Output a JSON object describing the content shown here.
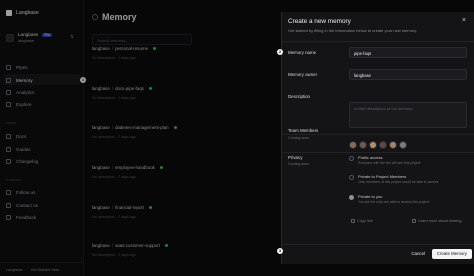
{
  "brand": {
    "name": "Langbase"
  },
  "org": {
    "name": "Langbase",
    "plan_badge": "Pro",
    "subtitle": "langbase"
  },
  "sidebar": {
    "items": [
      {
        "label": "Pipes",
        "icon": "pipe-icon"
      },
      {
        "label": "Memory",
        "icon": "memory-icon"
      },
      {
        "label": "Analytics",
        "icon": "analytics-icon"
      },
      {
        "label": "Explore",
        "icon": "explore-icon"
      }
    ],
    "section_learn": "Learn",
    "learn_items": [
      {
        "label": "Docs"
      },
      {
        "label": "Guides"
      },
      {
        "label": "Changelog"
      }
    ],
    "section_connect": "Connect",
    "connect_items": [
      {
        "label": "Follow us"
      },
      {
        "label": "Contact us"
      },
      {
        "label": "Feedback"
      }
    ],
    "badge": "1",
    "footer": {
      "left": "Langbase",
      "right": "Get Started Here"
    }
  },
  "main": {
    "title": "Memory",
    "search_placeholder": "Search memory...",
    "memories": [
      {
        "owner": "langbase",
        "name": "personal-resume",
        "desc": "No description",
        "time": "2 days ago"
      },
      {
        "owner": "langbase",
        "name": "docs-pipe-faqs",
        "desc": "No description",
        "time": "2 days ago"
      },
      {
        "owner": "langbase",
        "name": "diabetes-management-plan",
        "desc": "No description",
        "time": "2 days ago"
      },
      {
        "owner": "langbase",
        "name": "employee-handbook",
        "desc": "No description",
        "time": "2 days ago"
      },
      {
        "owner": "langbase",
        "name": "financial-report",
        "desc": "No description",
        "time": "2 days ago"
      },
      {
        "owner": "langbase",
        "name": "saas-customer-support",
        "desc": "No description",
        "time": "2 days ago"
      }
    ]
  },
  "modal": {
    "title": "Create a new memory",
    "description": "Get started by filling in the information below to create your new memory.",
    "memory_name_label": "Memory name",
    "memory_name_value": "pipe-faqs",
    "memory_owner_label": "Memory owner",
    "memory_owner_value": "langbase",
    "description_label": "Description",
    "description_placeholder": "A brief description of the memory",
    "team_members_label": "Team Members",
    "team_members_sub": "Coming soon",
    "privacy_label": "Privacy",
    "privacy_sub": "Coming soon",
    "privacy_options": [
      {
        "title": "Public access",
        "sub": "Everyone with the link will see this project",
        "checked": false
      },
      {
        "title": "Private to Project Members",
        "sub": "Only members of this project would be able to access",
        "checked": false
      },
      {
        "title": "Private to you",
        "sub": "You are the only one able to access this project",
        "checked": true
      }
    ],
    "copy_link": "Copy link",
    "learn_more": "Learn more about sharing",
    "cancel": "Cancel",
    "create": "Create Memory",
    "step_top": "2",
    "step_bottom": "3"
  },
  "colors": {
    "accent": "#3b3fc8",
    "status": "#34c759"
  }
}
